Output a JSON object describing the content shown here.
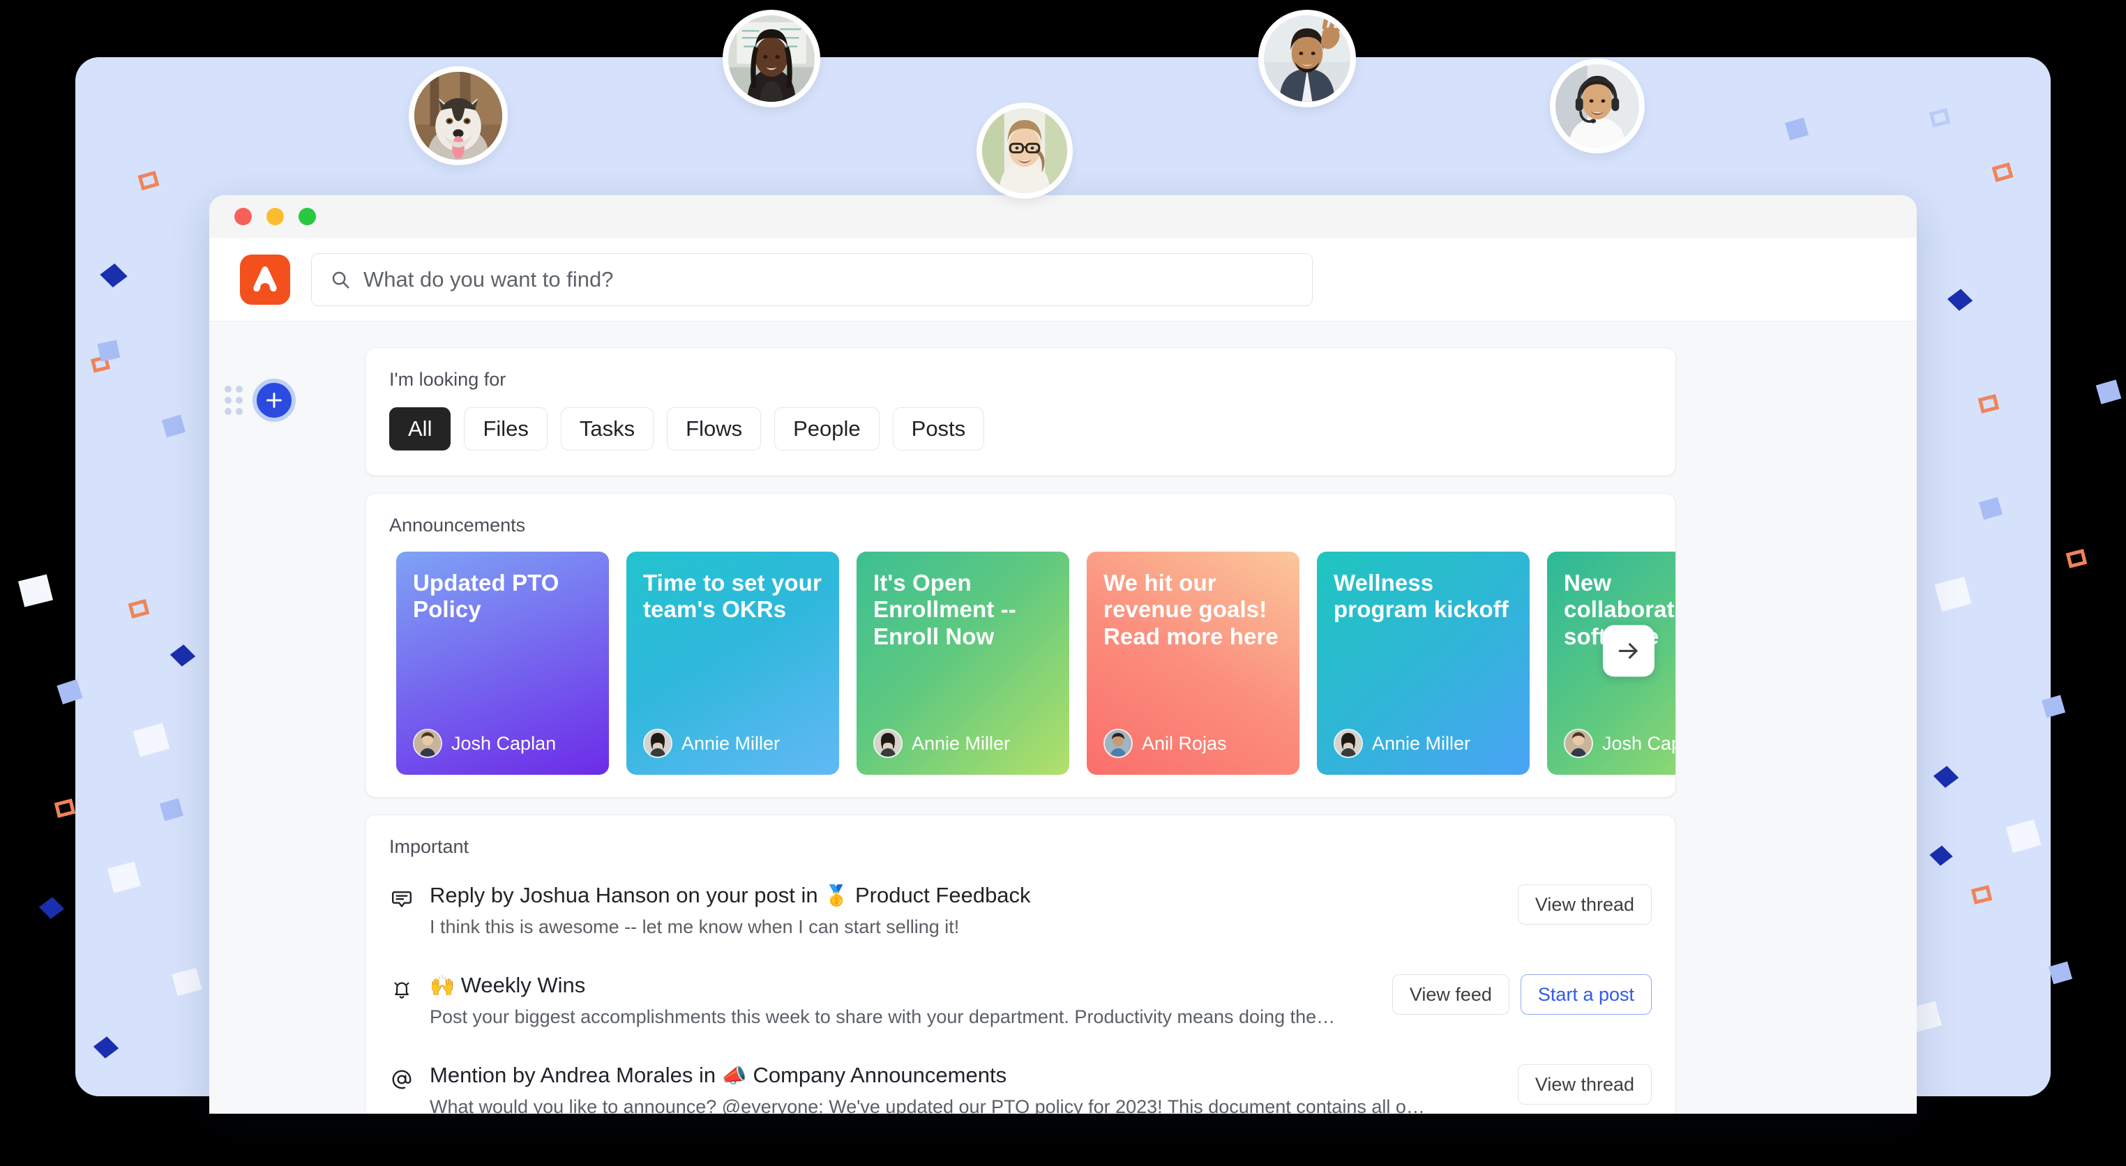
{
  "window": {
    "traffic_lights": [
      "close",
      "minimize",
      "maximize"
    ]
  },
  "brand": {
    "logo_icon": "assembly-logo-icon",
    "logo_color": "#F4501E"
  },
  "search": {
    "icon": "search-icon",
    "placeholder": "What do you want to find?",
    "value": ""
  },
  "fab": {
    "icon": "plus-icon",
    "color": "#2B4BE0",
    "grip_icon": "drag-grip-icon"
  },
  "looking_for": {
    "label": "I'm looking for",
    "chips": [
      {
        "label": "All",
        "active": true
      },
      {
        "label": "Files",
        "active": false
      },
      {
        "label": "Tasks",
        "active": false
      },
      {
        "label": "Flows",
        "active": false
      },
      {
        "label": "People",
        "active": false
      },
      {
        "label": "Posts",
        "active": false
      }
    ]
  },
  "announcements": {
    "label": "Announcements",
    "next_icon": "arrow-right-icon",
    "cards": [
      {
        "title": "Updated PTO Policy",
        "author": "Josh Caplan",
        "gradient_from": "#7FA3F5",
        "gradient_to": "#6C2BE8",
        "avatar": "josh-caplan-avatar"
      },
      {
        "title": "Time to set your team's OKRs",
        "author": "Annie Miller",
        "gradient_from": "#22C3CE",
        "gradient_to": "#63B8F5",
        "avatar": "annie-miller-avatar"
      },
      {
        "title": "It's Open Enrollment -- Enroll Now",
        "author": "Annie Miller",
        "gradient_from": "#3DBF93",
        "gradient_to": "#B3E06A",
        "avatar": "annie-miller-avatar"
      },
      {
        "title": "We hit our revenue goals! Read more here",
        "author": "Anil Rojas",
        "gradient_from": "#FA7A72",
        "gradient_to": "#FBC79B",
        "avatar": "anil-rojas-avatar"
      },
      {
        "title": "Wellness program kickoff",
        "author": "Annie Miller",
        "gradient_from": "#1FC5C0",
        "gradient_to": "#4AA3F5",
        "avatar": "annie-miller-avatar"
      },
      {
        "title": "New collaboration software",
        "author": "Josh Caplan",
        "gradient_from": "#2DB89A",
        "gradient_to": "#A9E06B",
        "avatar": "josh-caplan-avatar"
      }
    ]
  },
  "important": {
    "label": "Important",
    "rows": [
      {
        "icon": "comment-icon",
        "title_prefix": "Reply by Joshua Hanson on your post in ",
        "emoji": "🥇",
        "title_suffix": " Product Feedback",
        "subtitle": "I think this is awesome -- let me know when I can start selling it!",
        "actions": [
          {
            "label": "View thread",
            "style": "default"
          }
        ]
      },
      {
        "icon": "bell-icon",
        "title_prefix": "",
        "emoji": "🙌",
        "title_suffix": " Weekly Wins",
        "subtitle": "Post your biggest accomplishments this week to share with your department. Productivity means doing the…",
        "actions": [
          {
            "label": "View feed",
            "style": "default"
          },
          {
            "label": "Start a post",
            "style": "primary-outline"
          }
        ]
      },
      {
        "icon": "mention-icon",
        "title_prefix": "Mention by Andrea Morales in ",
        "emoji": "📣",
        "title_suffix": " Company Announcements",
        "subtitle": "What would you like to announce? @everyone: We've updated our PTO policy for 2023! This document contains all of…",
        "actions": [
          {
            "label": "View thread",
            "style": "default"
          }
        ]
      }
    ]
  },
  "floating_avatars": [
    {
      "name": "husky-dog-avatar",
      "kind": "dog"
    },
    {
      "name": "woman-braids-avatar",
      "kind": "woman-dark"
    },
    {
      "name": "woman-glasses-avatar",
      "kind": "woman-glasses"
    },
    {
      "name": "man-waving-avatar",
      "kind": "man-wave"
    },
    {
      "name": "man-headset-avatar",
      "kind": "man-headset"
    }
  ],
  "theme": {
    "backdrop": "#D6E2FB",
    "accent_blue": "#2F5BEA",
    "brand_orange": "#F4501E",
    "chip_active_bg": "#242424"
  }
}
